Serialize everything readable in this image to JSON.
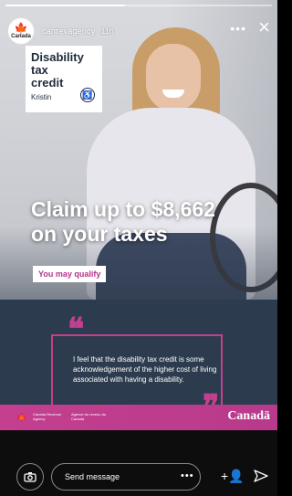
{
  "story": {
    "progress": 0.45,
    "account": {
      "avatar_text": "Canada",
      "avatar_icon": "maple-leaf-icon",
      "username": "canrevagency",
      "time": "11h"
    },
    "more_icon": "more-options-icon",
    "close_icon": "close-icon"
  },
  "title_card": {
    "line1": "Disability",
    "line2": "tax",
    "line3": "credit",
    "name": "Kristin",
    "icon": "accessibility-icon"
  },
  "headline": {
    "line1": "Claim up to $8,662",
    "line2": "on your taxes"
  },
  "cta": {
    "label": "You may qualify"
  },
  "quote": {
    "open_mark": "❝",
    "close_mark": "❞",
    "text": "I feel that the disability tax credit is some acknowledgement of the higher cost of living associated with having a disability."
  },
  "brand": {
    "flag_icon": "canada-flag-icon",
    "dept_en": "Canada Revenue Agency",
    "dept_fr": "Agence du revenu du Canada",
    "wordmark": "Canadä"
  },
  "reply": {
    "camera_icon": "camera-icon",
    "placeholder": "Send message",
    "more_icon": "more-icon",
    "add_icon": "add-person-icon",
    "send_icon": "send-icon"
  },
  "colors": {
    "accent_magenta": "#c43f8f",
    "panel_navy": "#2c3c4e",
    "title_text": "#1e2a3a"
  }
}
